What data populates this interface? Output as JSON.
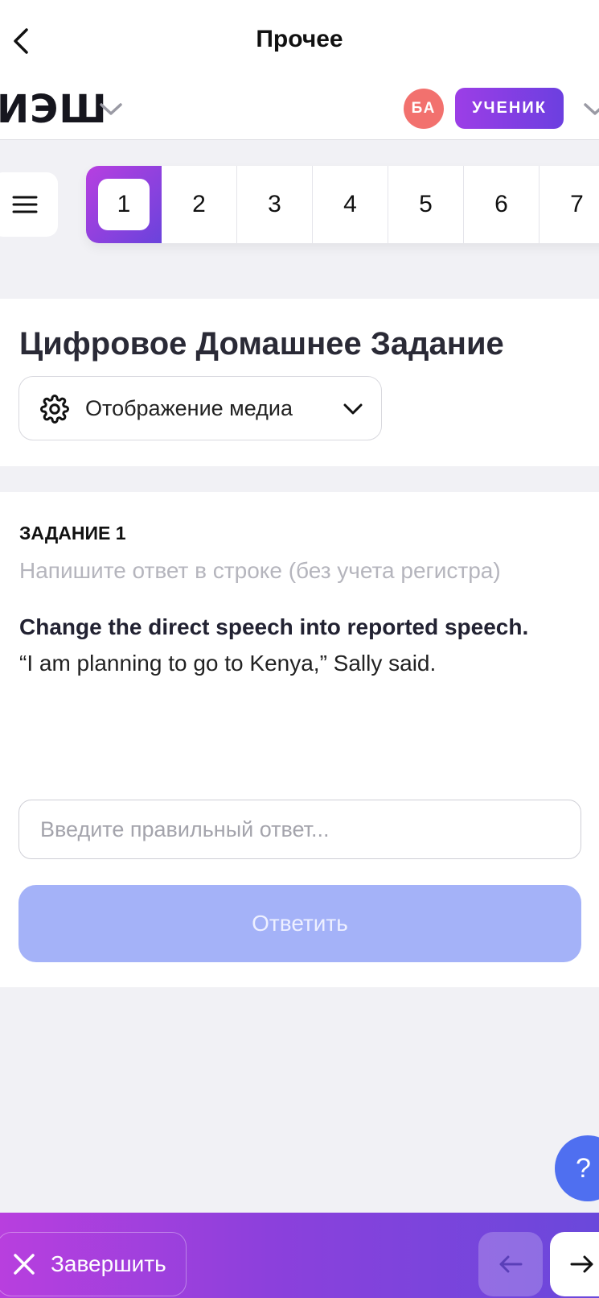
{
  "navbar": {
    "title": "Прочее",
    "back_icon": "chevron-left-icon"
  },
  "header": {
    "logo": "ИЭШ",
    "avatar_initials": "БА",
    "role": "УЧЕНИК",
    "avatar_color": "#f2716e",
    "accent_gradient": [
      "#9c3ee6",
      "#6c3fe0"
    ]
  },
  "task_nav": {
    "menu_icon": "hamburger-icon",
    "tabs": [
      "1",
      "2",
      "3",
      "4",
      "5",
      "6",
      "7"
    ],
    "active_index": 0
  },
  "title_card": {
    "title": "Цифровое Домашнее Задание",
    "media_select": {
      "icon": "gear-icon",
      "label": "Отображение медиа",
      "chevron": "chevron-down-icon"
    }
  },
  "task": {
    "number": "ЗАДАНИЕ 1",
    "hint": "Напишите ответ в строке (без учета регистра)",
    "instruction": "Change the direct speech into reported speech.",
    "sentence": "“I am planning to go to Kenya,” Sally said.",
    "input_placeholder": "Введите правильный ответ...",
    "input_value": "",
    "submit_label": "Ответить",
    "submit_color": "#a4b2f8"
  },
  "help": {
    "label": "?",
    "color": "#4f6ff0"
  },
  "bottom_bar": {
    "finish_label": "Завершить",
    "finish_icon": "close-icon",
    "prev_icon": "arrow-left-icon",
    "next_icon": "arrow-right-icon"
  }
}
